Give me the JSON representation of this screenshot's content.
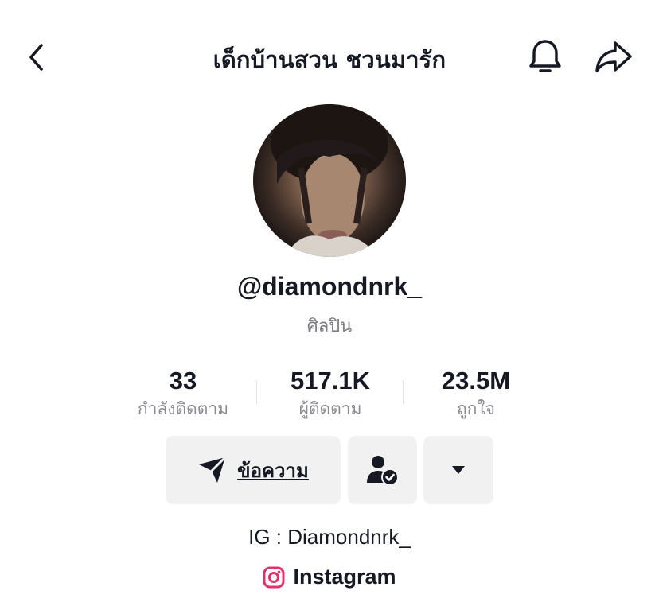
{
  "header": {
    "title": "เด็กบ้านสวน ชวนมารัก",
    "back_icon": "chevron-left-icon",
    "bell_icon": "bell-icon",
    "share_icon": "share-icon"
  },
  "profile": {
    "username": "@diamondnrk_",
    "category": "ศิลปิน"
  },
  "stats": {
    "following": {
      "value": "33",
      "label": "กำลังติดตาม"
    },
    "followers": {
      "value": "517.1K",
      "label": "ผู้ติดตาม"
    },
    "likes": {
      "value": "23.5M",
      "label": "ถูกใจ"
    }
  },
  "actions": {
    "message_label": "ข้อความ",
    "message_icon": "send-icon",
    "friend_icon": "user-check-icon",
    "more_icon": "caret-down-icon"
  },
  "bio": {
    "text": "IG : Diamondnrk_",
    "link_label": "Instagram",
    "link_icon": "instagram-icon"
  },
  "colors": {
    "text": "#161823",
    "muted": "#8a8b91",
    "button_bg": "#f1f1f2",
    "instagram": "#e1306c"
  }
}
